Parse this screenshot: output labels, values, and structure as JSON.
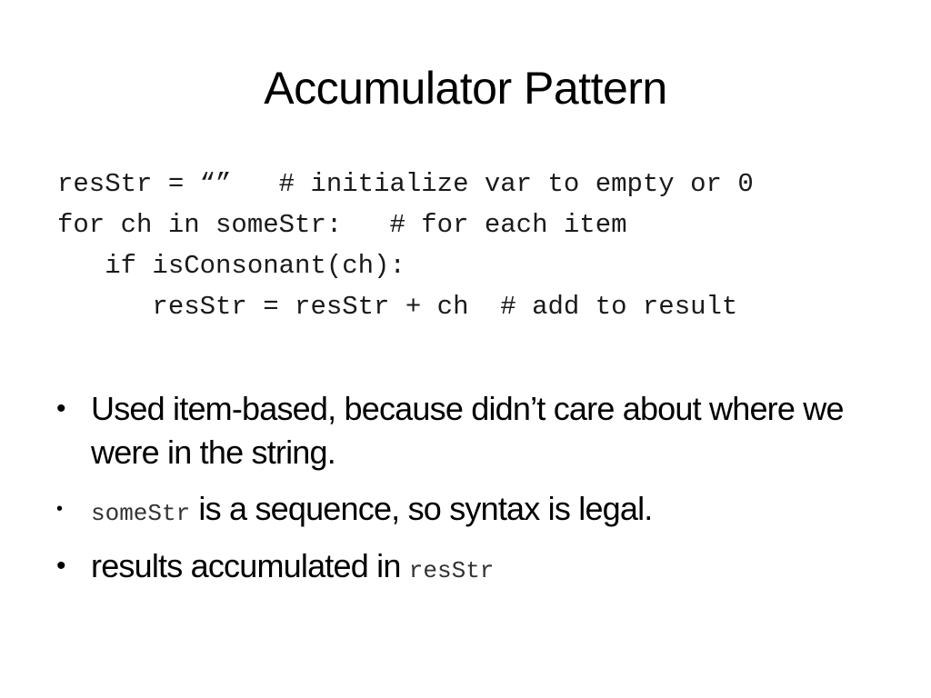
{
  "slide": {
    "title": "Accumulator Pattern",
    "code_lines": [
      "resStr = “”   # initialize var to empty or 0",
      "for ch in someStr:   # for each item",
      "   if isConsonant(ch):",
      "      resStr = resStr + ch  # add to result"
    ],
    "bullets": [
      {
        "bullet_glyph": "•",
        "code": "",
        "text": "Used item-based, because didn’t care about where we were in the string."
      },
      {
        "bullet_glyph": "•",
        "code": "someStr",
        "text": " is a sequence, so syntax is legal."
      },
      {
        "bullet_glyph": "•",
        "text": "results accumulated in ",
        "code": "resStr"
      }
    ]
  }
}
